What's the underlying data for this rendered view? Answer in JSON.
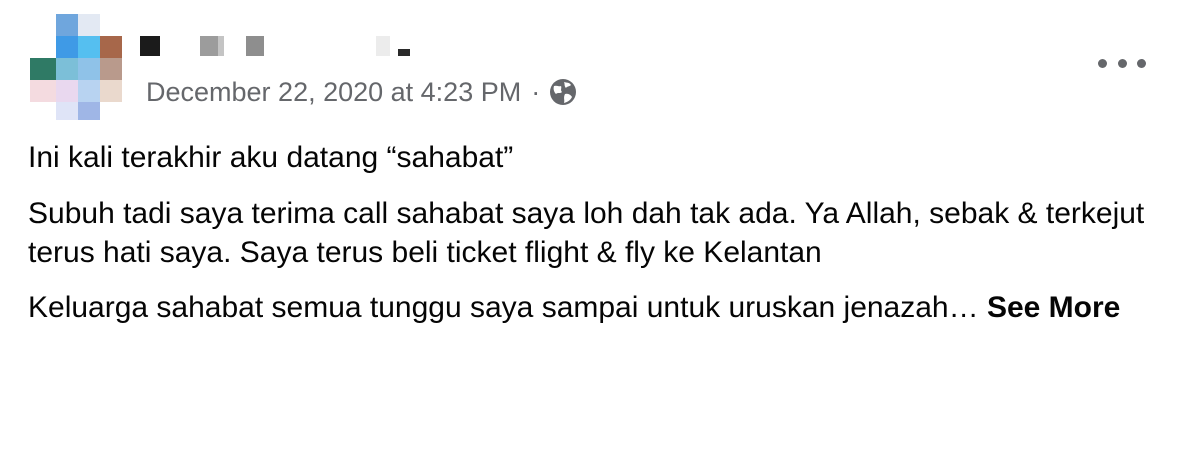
{
  "post": {
    "author_name": "",
    "timestamp": "December 22, 2020 at 4:23 PM",
    "separator": "·",
    "privacy_icon": "globe-icon",
    "more_icon": "more-horizontal-icon",
    "paragraphs": [
      "Ini kali terakhir aku datang “sahabat”",
      "Subuh tadi saya terima call sahabat saya loh dah tak ada. Ya Allah, sebak & terkejut terus hati saya. Saya terus beli ticket flight & fly ke Kelantan",
      "Keluarga sahabat semua tunggu saya sampai untuk uruskan jenazah…"
    ],
    "see_more_label": "See More"
  },
  "colors": {
    "text_primary": "#050505",
    "text_secondary": "#65676b",
    "background": "#ffffff"
  }
}
